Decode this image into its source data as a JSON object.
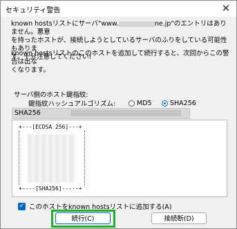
{
  "window": {
    "title": "セキュリティ警告",
    "close_glyph": "✕"
  },
  "warning_text": {
    "line1": "known hostsリストにサーバ\"www.",
    "line1_host_suffix": "ne.jp\"のエントリはありません。悪意",
    "line2": "を持ったホストが、接続しようとしているサーバのふりをしている可能性もありま",
    "line3": "す。十分注意してください!"
  },
  "info_text": {
    "line1": "known hostsリストのこのホストを追加して続行すると、次回からこの警告は出な",
    "line2": "くなります。"
  },
  "fingerprint": {
    "label": "サーバ側のホスト鍵指紋:",
    "algorithm_label": "鍵指紋ハッシュアルゴリズム:",
    "options": [
      {
        "label": "MD5",
        "selected": false
      },
      {
        "label": "SHA256",
        "selected": true
      }
    ],
    "value_prefix": "SHA256"
  },
  "randomart": {
    "header": "+---[ECDSA 256]---+",
    "footer": "+----[SHA256]-----+"
  },
  "add_host_checkbox": {
    "label": "このホストをknown hostsリストに追加する(A)",
    "checked": true,
    "check_glyph": "✓"
  },
  "buttons": {
    "continue": "続行(C)",
    "disconnect": "接続断(D)"
  },
  "colors": {
    "accent": "#0067c0",
    "highlight": "#1fb02a"
  }
}
